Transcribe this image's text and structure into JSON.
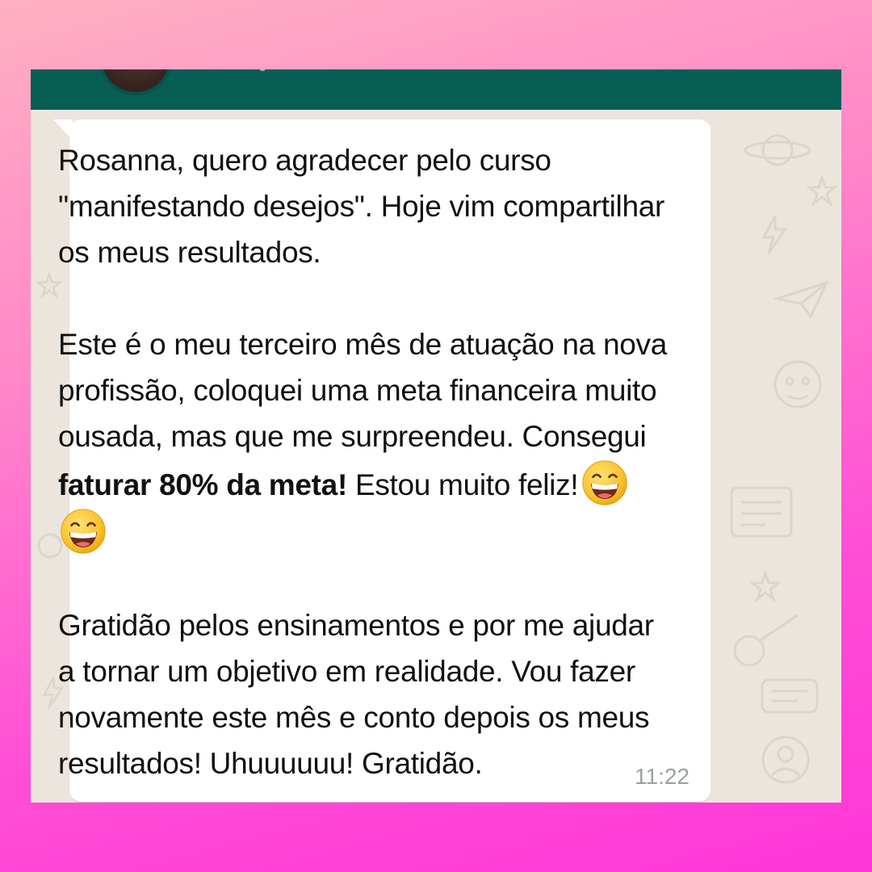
{
  "chat": {
    "header_color": "#075e54",
    "background_color": "#ece5dd",
    "bubble_color": "#ffffff"
  },
  "message": {
    "p1": "Rosanna, quero agradecer pelo curso \"manifestando desejos\". Hoje vim compartilhar os meus resultados.",
    "p2_start": "Este é o meu terceiro mês de atuação na nova profissão, coloquei uma meta financeira muito ousada, mas que me surpreendeu. Consegui ",
    "p2_bold": "faturar 80% da meta!",
    "p2_end": " Estou muito feliz!",
    "emojis": [
      "grinning-face-with-smiling-eyes",
      "grinning-face-with-smiling-eyes"
    ],
    "p3": "Gratidão pelos ensinamentos e por me ajudar a tornar um objetivo em realidade.  Vou fazer novamente este mês e conto depois os meus resultados! Uhuuuuuu! Gratidão.",
    "time": "11:22"
  }
}
